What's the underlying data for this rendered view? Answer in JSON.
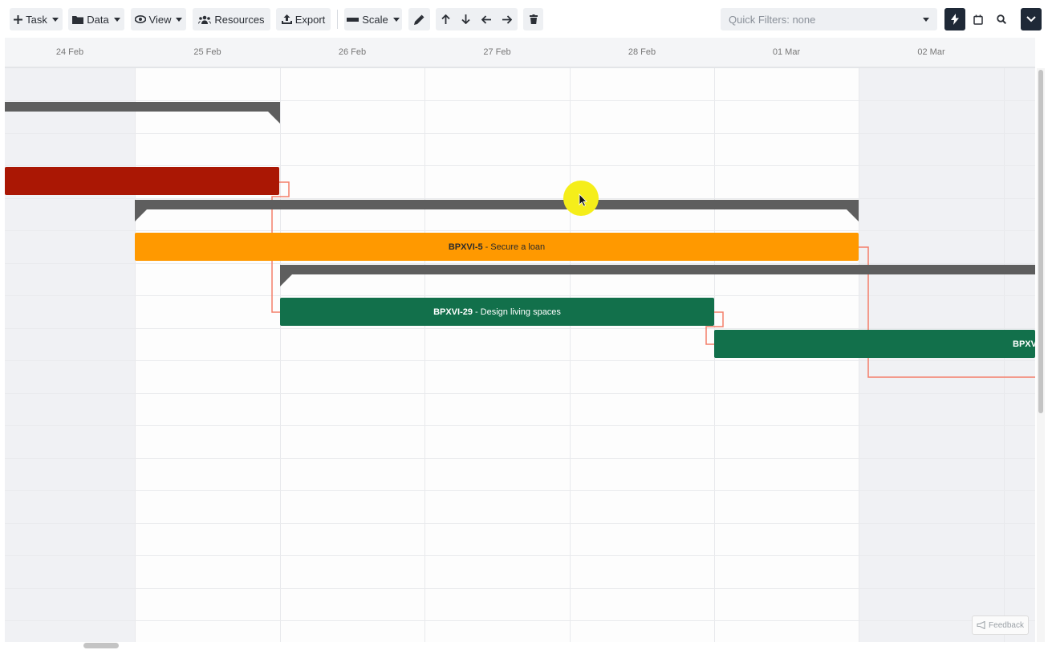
{
  "toolbar": {
    "task_label": "Task",
    "data_label": "Data",
    "view_label": "View",
    "resources_label": "Resources",
    "export_label": "Export",
    "scale_label": "Scale",
    "quick_filters_text": "Quick Filters: none",
    "icons": [
      "plus-icon",
      "folder-icon",
      "eye-icon",
      "users-icon",
      "upload-icon",
      "ruler-icon",
      "pencil-icon",
      "arrow-up-icon",
      "arrow-down-icon",
      "arrow-left-icon",
      "arrow-right-icon",
      "trash-icon",
      "lightning-icon",
      "calendar-icon",
      "search-icon",
      "chevron-down-icon"
    ]
  },
  "timeline": {
    "days": [
      "24 Feb",
      "25 Feb",
      "26 Feb",
      "27 Feb",
      "28 Feb",
      "01 Mar",
      "02 Mar"
    ],
    "weekend_days": [
      "24 Feb",
      "02 Mar"
    ]
  },
  "tasks": [
    {
      "id": "BPXVI-5",
      "title": "Secure a loan",
      "color": "#ff9900"
    },
    {
      "id": "BPXVI-29",
      "title": "Design living spaces",
      "color": "#12704b"
    },
    {
      "id": "BPXV",
      "title": "",
      "color": "#12704b"
    }
  ],
  "colors": {
    "blocked_task": "#aa1704",
    "summary": "#5e5e5e",
    "dependency": "#f47e6a",
    "toolbar_dark": "#1f2937"
  },
  "feedback_label": "Feedback"
}
